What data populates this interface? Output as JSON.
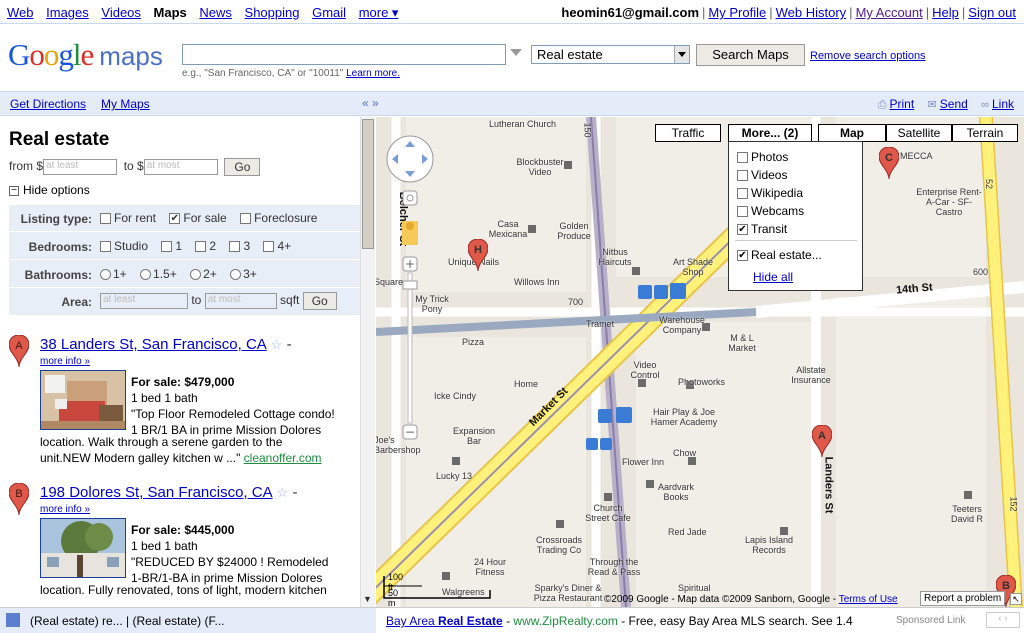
{
  "topnav": {
    "links": [
      "Web",
      "Images",
      "Videos",
      "Maps",
      "News",
      "Shopping",
      "Gmail",
      "more ▾"
    ],
    "selected": "Maps",
    "email": "heomin61@gmail.com",
    "account_links": [
      "My Profile",
      "Web History",
      "My Account",
      "Help",
      "Sign out"
    ]
  },
  "header": {
    "logo_maps": "maps",
    "search_value": "",
    "search_hint": "e.g., \"San Francisco, CA\" or \"10011\"",
    "search_hint_link": "Learn more.",
    "category": "Real estate",
    "search_button": "Search Maps",
    "remove_options": "Remove search options"
  },
  "toolbar": {
    "get_directions": "Get Directions",
    "my_maps": "My Maps",
    "collapse": "« »",
    "print": "Print",
    "send": "Send",
    "link": "Link"
  },
  "panel": {
    "title": "Real estate",
    "from_label": "from $",
    "to_label": "to $",
    "min_placeholder": "at least",
    "max_placeholder": "at most",
    "go": "Go",
    "hide_options": "Hide options",
    "listing_type": {
      "label": "Listing type:",
      "options": [
        {
          "text": "For rent",
          "checked": false
        },
        {
          "text": "For sale",
          "checked": true
        },
        {
          "text": "Foreclosure",
          "checked": false
        }
      ]
    },
    "bedrooms": {
      "label": "Bedrooms:",
      "options": [
        "Studio",
        "1",
        "2",
        "3",
        "4+"
      ]
    },
    "bathrooms": {
      "label": "Bathrooms:",
      "options": [
        "1+",
        "1.5+",
        "2+",
        "3+"
      ]
    },
    "area": {
      "label": "Area:",
      "min_placeholder": "at least",
      "to": "to",
      "max_placeholder": "at most",
      "unit": "sqft",
      "go": "Go"
    },
    "results": [
      {
        "marker": "A",
        "title": "38 Landers St, San Francisco, CA",
        "more_info": "more info »",
        "price": "For sale: $479,000",
        "beds_baths": "1 bed 1 bath",
        "desc_lines": [
          "\"Top Floor Remodeled Cottage condo!",
          "1 BR/1 BA in prime Mission Dolores"
        ],
        "desc_full": [
          "location. Walk through a serene garden to the",
          "unit.NEW Modern galley kitchen w ...\" "
        ],
        "source": "cleanoffer.com"
      },
      {
        "marker": "B",
        "title": "198 Dolores St, San Francisco, CA",
        "more_info": "more info »",
        "price": "For sale: $445,000",
        "beds_baths": "1 bed 1 bath",
        "desc_lines": [
          "\"REDUCED BY $24000 ! Remodeled",
          "1-BR/1-BA in prime Mission Dolores"
        ],
        "desc_full": [
          "location. Fully renovated, tons of light, modern kitchen"
        ],
        "source": ""
      }
    ]
  },
  "map": {
    "buttons": {
      "traffic": "Traffic",
      "more": "More... (2)",
      "map": "Map",
      "satellite": "Satellite",
      "terrain": "Terrain"
    },
    "more_menu": [
      {
        "text": "Photos",
        "checked": false
      },
      {
        "text": "Videos",
        "checked": false
      },
      {
        "text": "Wikipedia",
        "checked": false
      },
      {
        "text": "Webcams",
        "checked": false
      },
      {
        "text": "Transit",
        "checked": true
      },
      {
        "text": "Real estate...",
        "checked": true
      }
    ],
    "hide_all": "Hide all",
    "markers": [
      "A",
      "B",
      "C",
      "H"
    ],
    "street_labels": {
      "market": "Market St",
      "fourteenth": "14th St",
      "landers": "Landers St",
      "belcher": "Belcher St"
    },
    "places": {
      "lutheran_church": "Lutheran Church",
      "blockbuster": "Blockbuster Video",
      "casa_mexicana": "Casa Mexicana",
      "golden_produce": "Golden Produce",
      "nitbus_haircuts": "Nitbus Haircuts",
      "art_shade": "Art Shade Shop",
      "mecca": "MECCA",
      "enterprise": "Enterprise Rent-A-Car - SF-Castro",
      "unique_nails": "Unique Nails",
      "willows_inn": "Willows Inn",
      "my_trick_pony": "My Trick Pony",
      "trannet": "Tramet",
      "warehouse": "Warehouse Company",
      "ml_market": "M & L Market",
      "allstate": "Allstate Insurance",
      "pizza": "Pizza",
      "home": "Home",
      "video_control": "Video Control",
      "photoworks": "Photoworks",
      "icke_cindy": "Icke Cindy",
      "expansion_bar": "Expansion Bar",
      "hair_play": "Hair Play & Joe Hamer Academy",
      "chow": "Chow",
      "lucky13": "Lucky 13",
      "flower_inn": "Flower Inn",
      "aardvark": "Aardvark Books",
      "church_street_cafe": "Church Street Cafe",
      "red_jade": "Red Jade",
      "crossroads": "Crossroads Trading Co",
      "lapis_island": "Lapis Island Records",
      "teeters": "Teeters David R",
      "fitness": "24 Hour Fitness",
      "through_read": "Through the Read & Pass",
      "sparkys": "Sparky's Diner & Pizza Restaurant",
      "spiritual": "Spiritual",
      "walgreens": "Walgreens",
      "square": "Square",
      "joes_barbershop": "Joe's Barbershop",
      "n600": "600",
      "n700": "700",
      "n150": "150",
      "n152": "152",
      "n52": "52"
    },
    "scale_ft": "100 ft",
    "scale_m": "50 m",
    "copyright": "©2009 Google - Map data ©2009 Sanborn, Google -",
    "terms": "Terms of Use",
    "report": "Report a problem"
  },
  "bottom": {
    "status": "(Real estate) re... | (Real estate) (F...",
    "ad_title_prefix": "Bay Area ",
    "ad_title_kw": "Real Estate",
    "ad_url": "www.ZipRealty.com",
    "ad_text": "- Free, easy Bay Area MLS search. See 1.4",
    "sponsored": "Sponsored Link",
    "nav": "‹ ›"
  },
  "colors": {
    "link": "#0000cc",
    "toolbar_bg": "#e5ecf9",
    "map_bg": "#eae6de",
    "major_road": "#ffef7a",
    "marker": "#e0584a"
  }
}
